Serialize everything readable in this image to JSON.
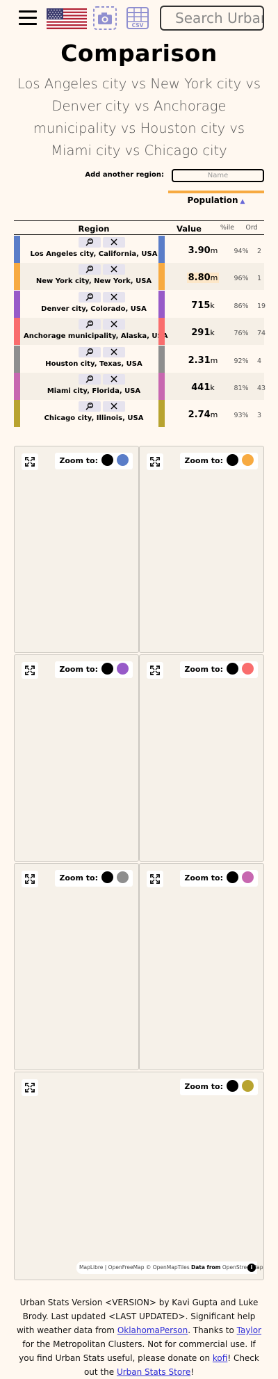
{
  "header": {
    "menu_icon": "hamburger-icon",
    "flag_icon": "us-flag-icon",
    "screenshot_icon": "camera-icon",
    "csv_icon": "csv-icon",
    "csv_label": "CSV",
    "search_placeholder": "Search Urban Stats"
  },
  "page": {
    "title": "Comparison",
    "subtitle": "Los Angeles city vs New York city vs Denver city vs Anchorage municipality vs Houston city vs Miami city vs Chicago city"
  },
  "add_region": {
    "label": "Add another region:",
    "placeholder": "Name"
  },
  "table": {
    "stat_name": "Population",
    "stat_color": "#f7aa41",
    "headers": {
      "region": "Region",
      "value": "Value",
      "percentile": "%ile",
      "ordinal": "Ord"
    },
    "rows": [
      {
        "name": "Los Angeles city, California, USA",
        "value": "3.90",
        "unit": "m",
        "percentile": "94%",
        "ordinal": "2",
        "color": "#5a7dc8"
      },
      {
        "name": "New York city, New York, USA",
        "value": "8.80",
        "unit": "m",
        "percentile": "96%",
        "ordinal": "1",
        "color": "#f7aa41"
      },
      {
        "name": "Denver city, Colorado, USA",
        "value": "715",
        "unit": "k",
        "percentile": "86%",
        "ordinal": "19",
        "color": "#975ac8"
      },
      {
        "name": "Anchorage municipality, Alaska, USA",
        "value": "291",
        "unit": "k",
        "percentile": "76%",
        "ordinal": "74",
        "color": "#f96d6d"
      },
      {
        "name": "Houston city, Texas, USA",
        "value": "2.31",
        "unit": "m",
        "percentile": "92%",
        "ordinal": "4",
        "color": "#8e8e8e"
      },
      {
        "name": "Miami city, Florida, USA",
        "value": "441",
        "unit": "k",
        "percentile": "81%",
        "ordinal": "43",
        "color": "#c767b0"
      },
      {
        "name": "Chicago city, Illinois, USA",
        "value": "2.74",
        "unit": "m",
        "percentile": "93%",
        "ordinal": "3",
        "color": "#b8a32f"
      }
    ]
  },
  "maps": {
    "zoom_label": "Zoom to:",
    "all_color": "#000000",
    "attribution": "MapLibre | OpenFreeMap © OpenMapTiles",
    "attribution_data": "Data from",
    "attribution_source": "OpenStreetMap"
  },
  "footer": {
    "text1": "Urban Stats Version <VERSION> by Kavi Gupta and Luke Brody. Last updated <LAST UPDATED>. Significant help with weather data from ",
    "link1": "OklahomaPerson",
    "text2": ". Thanks to ",
    "link2": "Taylor",
    "text3": " for the Metropolitan Clusters. Not for commercial use. If you find Urban Stats useful, please donate on ",
    "link3": "kofi",
    "text4": "! Check out the ",
    "link4": "Urban Stats Store",
    "text5": "!"
  }
}
